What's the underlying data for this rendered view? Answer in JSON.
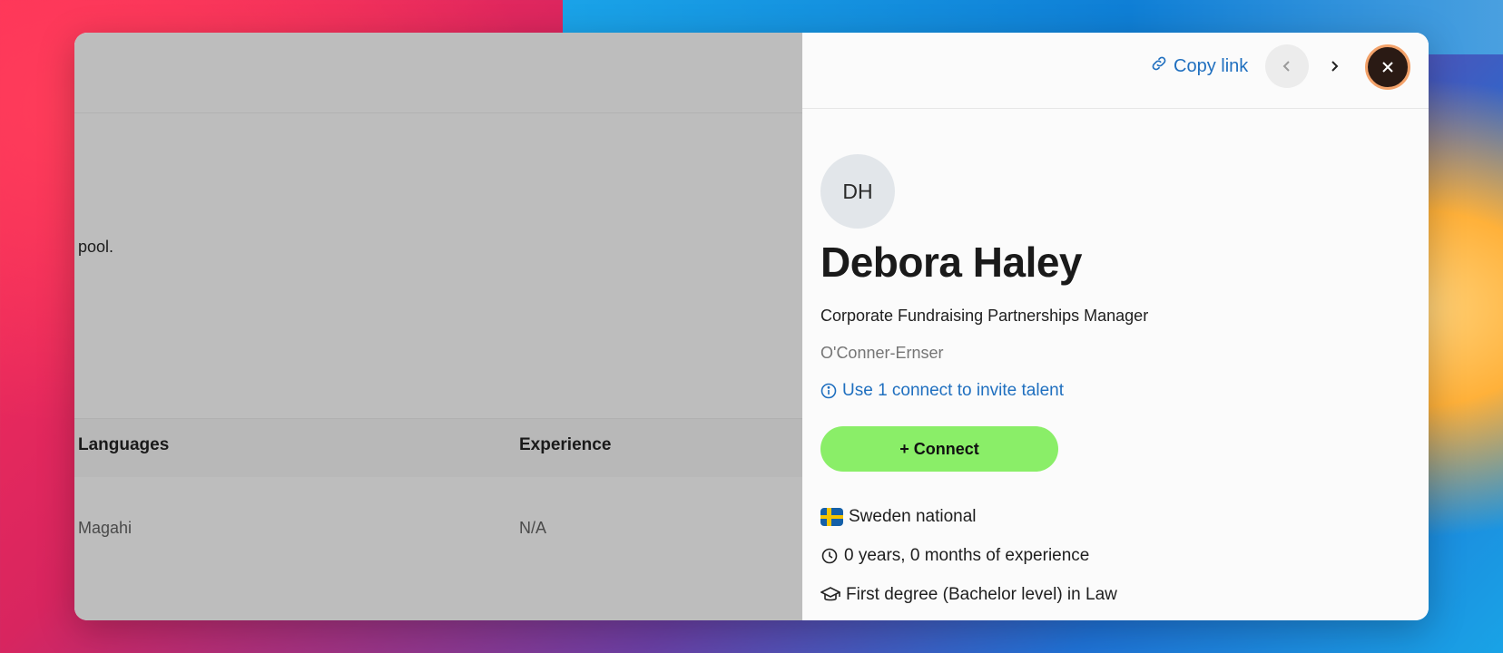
{
  "left": {
    "fragment_text": "pool.",
    "headers": [
      "Languages",
      "Experience"
    ],
    "row": [
      "Magahi",
      "N/A"
    ]
  },
  "topbar": {
    "copy_link_label": "Copy link"
  },
  "profile": {
    "initials": "DH",
    "name": "Debora Haley",
    "job_title": "Corporate Fundraising Partnerships Manager",
    "company": "O'Conner-Ernser",
    "invite_hint": "Use 1 connect to invite talent",
    "connect_label": "+ Connect",
    "nationality": "Sweden national",
    "experience": "0 years, 0 months of experience",
    "education": "First degree (Bachelor level) in Law"
  },
  "colors": {
    "accent_link": "#1f6fbf",
    "connect_button": "#8aee68",
    "overlay": "#bdbdbd"
  },
  "icons": [
    "link-icon",
    "chevron-left-icon",
    "chevron-right-icon",
    "close-icon",
    "info-icon",
    "sweden-flag-icon",
    "clock-icon",
    "graduation-cap-icon"
  ]
}
